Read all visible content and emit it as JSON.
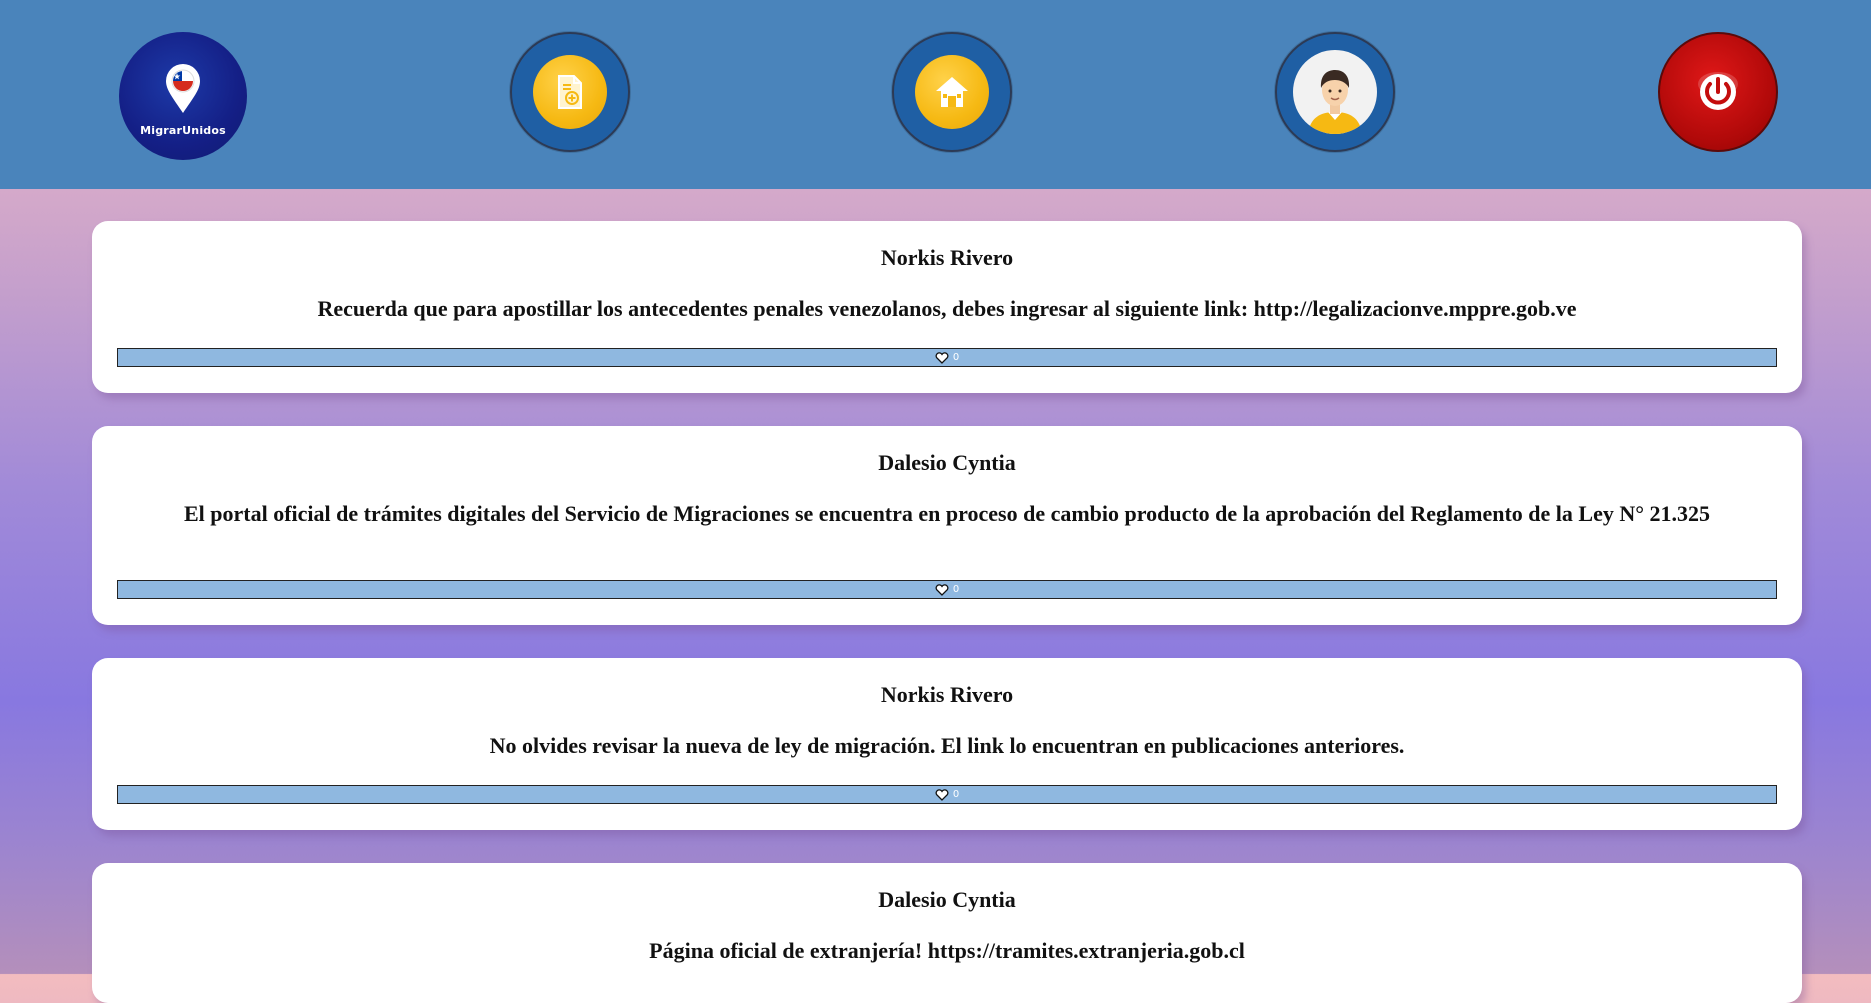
{
  "header": {
    "logo_text": "MigrarUnidos",
    "buttons": [
      {
        "icon": "document-add-icon"
      },
      {
        "icon": "home-icon"
      },
      {
        "icon": "user-avatar-icon"
      },
      {
        "icon": "power-icon"
      }
    ],
    "colors": {
      "header_bg": "#4a84bb",
      "ring": "#1f5fa4",
      "gold": "#f6b913",
      "power": "#b00909"
    }
  },
  "posts": [
    {
      "author": "Norkis Rivero",
      "message": "Recuerda que para apostillar los antecedentes penales venezolanos, debes ingresar al siguiente link: http://legalizacionve.mppre.gob.ve",
      "likes": "0"
    },
    {
      "author": "Dalesio Cyntia",
      "message": "El portal oficial de trámites digitales del Servicio de Migraciones se encuentra en proceso de cambio producto de la aprobación del Reglamento de la Ley N° 21.325",
      "likes": "0"
    },
    {
      "author": "Norkis Rivero",
      "message": "No olvides revisar la nueva de ley de migración. El link lo encuentran en publicaciones anteriores.",
      "likes": "0"
    },
    {
      "author": "Dalesio Cyntia",
      "message": "Página oficial de extranjería! https://tramites.extranjeria.gob.cl"
    }
  ]
}
